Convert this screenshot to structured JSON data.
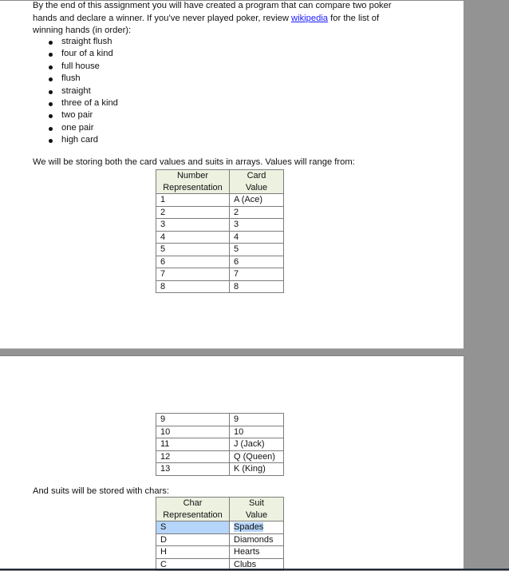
{
  "intro": {
    "text_before_link": "By the end of this assignment you will have created a program that can compare two poker hands and declare a winner. If you’ve never played poker, review ",
    "link_text": "wikipedia",
    "text_after_link": " for the list of winning hands (in order):"
  },
  "winning_hands": [
    "straight flush",
    "four of a kind",
    "full house",
    "flush",
    "straight",
    "three of a kind",
    "two pair",
    "one pair",
    "high card"
  ],
  "values_intro": "We will be storing both the card values and suits in arrays. Values will range from:",
  "values_table": {
    "headers": [
      "Number\nRepresentation",
      "Card\nValue"
    ],
    "header_lines": [
      [
        "Number",
        "Representation"
      ],
      [
        "Card",
        "Value"
      ]
    ],
    "rows_page1": [
      [
        "1",
        "A (Ace)"
      ],
      [
        "2",
        "2"
      ],
      [
        "3",
        "3"
      ],
      [
        "4",
        "4"
      ],
      [
        "5",
        "5"
      ],
      [
        "6",
        "6"
      ],
      [
        "7",
        "7"
      ],
      [
        "8",
        "8"
      ]
    ],
    "rows_page2": [
      [
        "9",
        "9"
      ],
      [
        "10",
        "10"
      ],
      [
        "11",
        "J (Jack)"
      ],
      [
        "12",
        "Q (Queen)"
      ],
      [
        "13",
        "K (King)"
      ]
    ]
  },
  "suits_intro": "And suits will be stored with chars:",
  "suits_table": {
    "header_lines": [
      [
        "Char",
        "Representation"
      ],
      [
        "Suit",
        "Value"
      ]
    ],
    "rows": [
      [
        "S",
        "Spades"
      ],
      [
        "D",
        "Diamonds"
      ],
      [
        "H",
        "Hearts"
      ],
      [
        "C",
        "Clubs"
      ]
    ],
    "selected_row": 0
  },
  "colors": {
    "link": "#1a1aff",
    "table_header_bg": "#ecf1e0",
    "selection": "#b5d5fa",
    "viewer_bg": "#939393"
  }
}
